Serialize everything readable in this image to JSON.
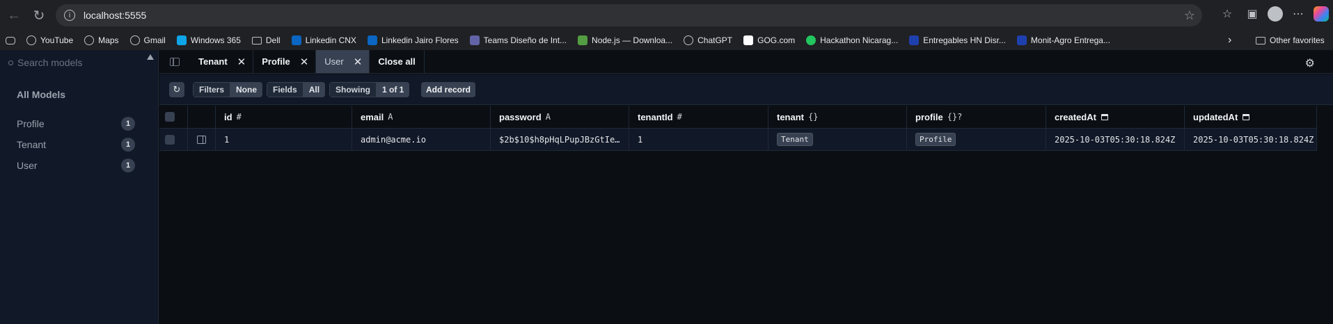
{
  "browser": {
    "url": "localhost:5555",
    "bookmarks": [
      {
        "label": "YouTube",
        "icon": "globe-icon"
      },
      {
        "label": "Maps",
        "icon": "globe-icon"
      },
      {
        "label": "Gmail",
        "icon": "globe-icon"
      },
      {
        "label": "Windows 365",
        "icon": "windows365-icon"
      },
      {
        "label": "Dell",
        "icon": "folder-icon"
      },
      {
        "label": "Linkedin CNX",
        "icon": "linkedin-video-icon"
      },
      {
        "label": "Linkedin Jairo Flores",
        "icon": "linkedin-icon"
      },
      {
        "label": "Teams Diseño de Int...",
        "icon": "teams-icon"
      },
      {
        "label": "Node.js — Downloa...",
        "icon": "nodejs-icon"
      },
      {
        "label": "ChatGPT",
        "icon": "chatgpt-icon"
      },
      {
        "label": "GOG.com",
        "icon": "gog-icon"
      },
      {
        "label": "Hackathon Nicarag...",
        "icon": "hackathon-icon"
      },
      {
        "label": "Entregables HN Disr...",
        "icon": "entregables-icon"
      },
      {
        "label": "Monit-Agro Entrega...",
        "icon": "monit-icon"
      }
    ],
    "other_favorites": "Other favorites"
  },
  "sidebar": {
    "search_placeholder": "Search models",
    "heading": "All Models",
    "models": [
      {
        "name": "Profile",
        "count": "1"
      },
      {
        "name": "Tenant",
        "count": "1"
      },
      {
        "name": "User",
        "count": "1"
      }
    ]
  },
  "tabs": [
    {
      "label": "Tenant",
      "active": false
    },
    {
      "label": "Profile",
      "active": false
    },
    {
      "label": "User",
      "active": true
    }
  ],
  "close_all": "Close all",
  "toolbar": {
    "filters_label": "Filters",
    "filters_value": "None",
    "fields_label": "Fields",
    "fields_value": "All",
    "showing_label": "Showing",
    "showing_value": "1 of 1",
    "add_record": "Add record"
  },
  "table": {
    "columns": [
      {
        "name": "id",
        "type": "#"
      },
      {
        "name": "email",
        "type": "A"
      },
      {
        "name": "password",
        "type": "A"
      },
      {
        "name": "tenantId",
        "type": "#"
      },
      {
        "name": "tenant",
        "type": "{}"
      },
      {
        "name": "profile",
        "type": "{}?"
      },
      {
        "name": "createdAt",
        "type": "calendar"
      },
      {
        "name": "updatedAt",
        "type": "calendar"
      }
    ],
    "rows": [
      {
        "id": "1",
        "email": "admin@acme.io",
        "password": "$2b$10$h8pHqLPupJBzGtIe…",
        "tenantId": "1",
        "tenant": "Tenant",
        "profile": "Profile",
        "createdAt": "2025-10-03T05:30:18.824Z",
        "updatedAt": "2025-10-03T05:30:18.824Z"
      }
    ]
  }
}
